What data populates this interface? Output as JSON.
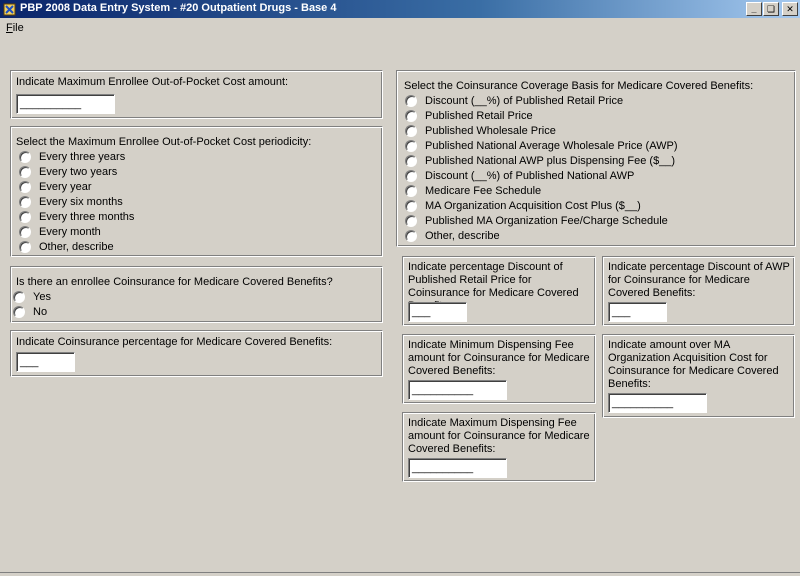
{
  "window": {
    "title": "PBP 2008 Data Entry System - #20 Outpatient Drugs - Base 4",
    "minimize_glyph": "_",
    "maximize_glyph": "❏",
    "close_glyph": "✕"
  },
  "menu": {
    "file_accel": "F",
    "file_rest": "ile"
  },
  "max_oop_amount": {
    "label": "Indicate Maximum Enrollee Out-of-Pocket Cost amount:",
    "value": "__________"
  },
  "max_oop_period": {
    "label": "Select the Maximum Enrollee Out-of-Pocket Cost periodicity:",
    "options": [
      "Every three years",
      "Every two years",
      "Every year",
      "Every six months",
      "Every three months",
      "Every month",
      "Other, describe"
    ]
  },
  "coinsurance_question": {
    "label": "Is there an enrollee Coinsurance for Medicare Covered Benefits?",
    "options": [
      "Yes",
      "No"
    ]
  },
  "coinsurance_pct": {
    "label": "Indicate Coinsurance percentage for Medicare Covered Benefits:",
    "value": "___"
  },
  "coverage_basis": {
    "label": "Select the Coinsurance Coverage Basis for Medicare Covered Benefits:",
    "options": [
      "Discount (__%) of Published Retail Price",
      "Published Retail Price",
      "Published Wholesale Price",
      "Published National Average Wholesale Price (AWP)",
      "Published National AWP plus Dispensing Fee ($__)",
      "Discount (__%) of Published National AWP",
      "Medicare Fee Schedule",
      "MA Organization Acquisition Cost Plus ($__)",
      "Published MA Organization Fee/Charge Schedule",
      "Other, describe"
    ]
  },
  "pct_discount_retail": {
    "label": "Indicate percentage Discount of Published Retail Price for Coinsurance for Medicare Covered Benefits:",
    "value": "___"
  },
  "pct_discount_awp": {
    "label": "Indicate percentage Discount of AWP for Coinsurance for Medicare Covered Benefits:",
    "value": "___"
  },
  "min_dispensing_fee": {
    "label": "Indicate Minimum Dispensing Fee amount for Coinsurance for Medicare Covered Benefits:",
    "value": "__________"
  },
  "amount_over_acq_cost": {
    "label": "Indicate amount over MA Organization Acquisition Cost for Coinsurance for Medicare Covered Benefits:",
    "value": "__________"
  },
  "max_dispensing_fee": {
    "label": "Indicate Maximum Dispensing Fee amount for Coinsurance for Medicare Covered Benefits:",
    "value": "__________"
  }
}
